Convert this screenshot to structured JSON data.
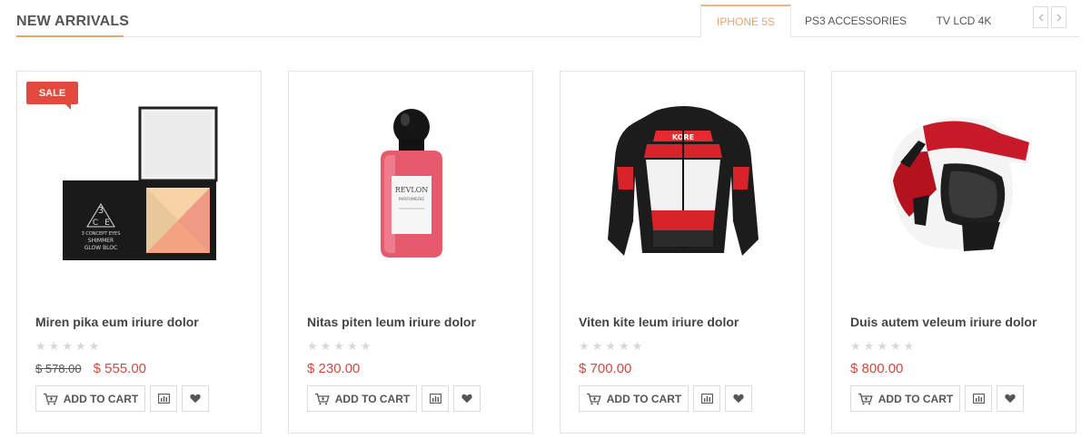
{
  "section": {
    "title": "NEW ARRIVALS",
    "accent_color": "#e8a46a"
  },
  "tabs": [
    {
      "label": "IPHONE 5S",
      "active": true
    },
    {
      "label": "PS3 ACCESSORIES",
      "active": false
    },
    {
      "label": "TV LCD 4K",
      "active": false
    }
  ],
  "nav": {
    "prev_icon": "chevron-left-icon",
    "next_icon": "chevron-right-icon"
  },
  "colors": {
    "price": "#d9473c",
    "sale_badge": "#e24a3d",
    "star_empty": "#d8d8d8"
  },
  "products": [
    {
      "name": "Miren pika eum iriure dolor",
      "badge": "SALE",
      "rating": 0,
      "old_price": "$ 578.00",
      "price": "$ 555.00",
      "image": "eyeshadow-palette",
      "image_text": [
        "3",
        "C",
        "E",
        "3 CONCEPT EYES",
        "SHIMMER",
        "GLOW BLOC"
      ],
      "add_to_cart": "ADD TO CART"
    },
    {
      "name": "Nitas piten leum iriure dolor",
      "rating": 0,
      "price": "$ 230.00",
      "image": "nail-polish-bottle",
      "image_text": [
        "REVLON",
        "PARFUMERIE"
      ],
      "add_to_cart": "ADD TO CART"
    },
    {
      "name": "Viten kite leum iriure dolor",
      "rating": 0,
      "price": "$ 700.00",
      "image": "motorcycle-jacket",
      "image_text": [
        "KORE"
      ],
      "add_to_cart": "ADD TO CART"
    },
    {
      "name": "Duis autem veleum iriure dolor",
      "rating": 0,
      "price": "$ 800.00",
      "image": "motocross-helmet",
      "add_to_cart": "ADD TO CART"
    }
  ]
}
